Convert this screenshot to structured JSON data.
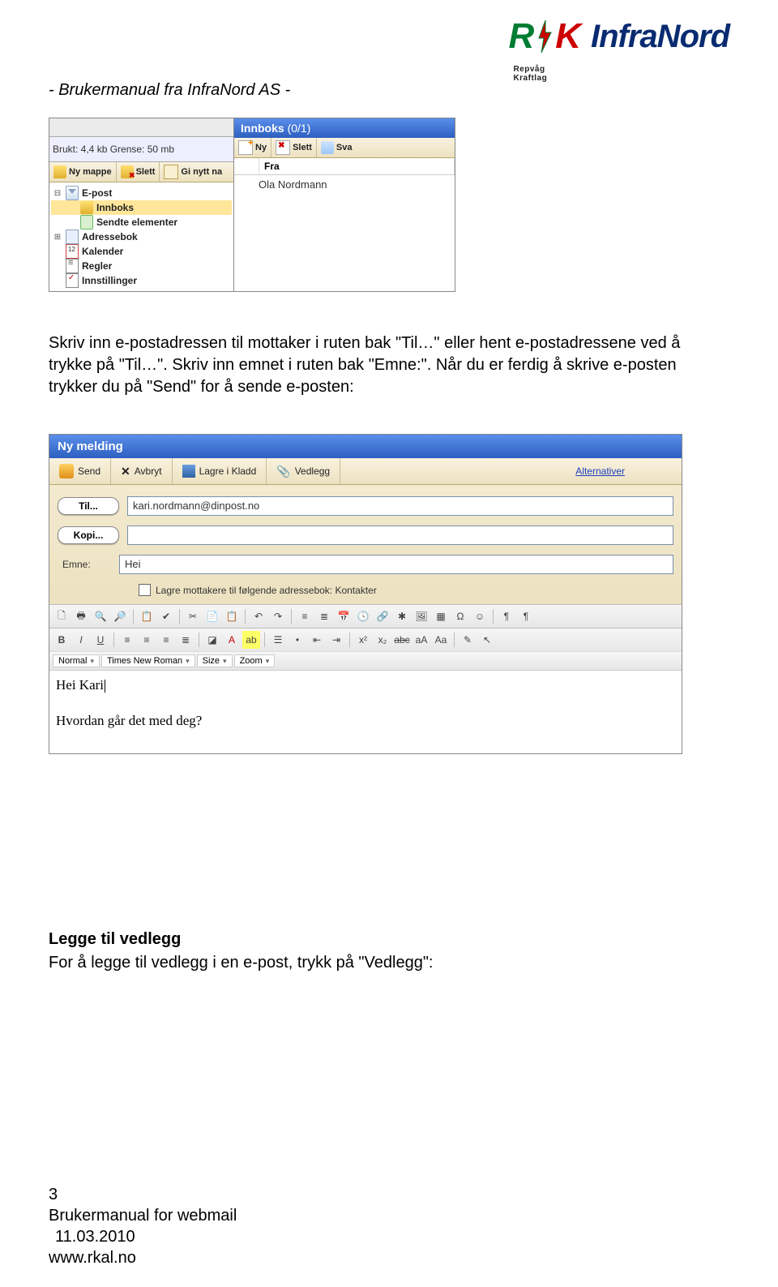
{
  "header": {
    "manual_line": "- Brukermanual fra InfraNord AS -",
    "logo_sub": "Repvåg Kraftlag",
    "logo_text": "InfraNord"
  },
  "shot1": {
    "quota": "Brukt: 4,4 kb Grense: 50 mb",
    "tb": {
      "new_folder": "Ny mappe",
      "delete": "Slett",
      "rename": "Gi nytt na"
    },
    "tree": {
      "epost": "E-post",
      "innboks": "Innboks",
      "sendte": "Sendte elementer",
      "adressebok": "Adressebok",
      "kalender": "Kalender",
      "regler": "Regler",
      "innstillinger": "Innstillinger"
    },
    "right": {
      "title": "Innboks",
      "count": "(0/1)",
      "tb": {
        "ny": "Ny",
        "slett": "Slett",
        "svar": "Sva"
      },
      "col_fra": "Fra",
      "sender": "Ola Nordmann"
    }
  },
  "para1": "Skriv inn e-postadressen til mottaker i ruten bak \"Til…\" eller hent e-postadressene ved å trykke på \"Til…\". Skriv inn emnet i ruten bak \"Emne:\". Når du er ferdig å skrive e-posten trykker du på \"Send\" for å sende e-posten:",
  "shot2": {
    "title": "Ny melding",
    "tb": {
      "send": "Send",
      "avbryt": "Avbryt",
      "lagre": "Lagre i Kladd",
      "vedlegg": "Vedlegg",
      "alt": "Alternativer"
    },
    "form": {
      "til_btn": "Til...",
      "til_val": "kari.nordmann@dinpost.no",
      "kopi_btn": "Kopi...",
      "kopi_val": "",
      "emne_lbl": "Emne:",
      "emne_val": "Hei",
      "chk_label": "Lagre mottakere til følgende adressebok: Kontakter"
    },
    "editor_selects": {
      "style": "Normal",
      "font": "Times New Roman",
      "size": "Size",
      "zoom": "Zoom"
    },
    "body": {
      "line1": "Hei Kari",
      "line2": "Hvordan går det med deg?"
    }
  },
  "para2": {
    "heading": "Legge til vedlegg",
    "text": "For å legge til vedlegg i en e-post, trykk på \"Vedlegg\":"
  },
  "footer": {
    "page": "3",
    "title": "Brukermanual for webmail",
    "date": "11.03.2010",
    "url": "www.rkal.no"
  }
}
